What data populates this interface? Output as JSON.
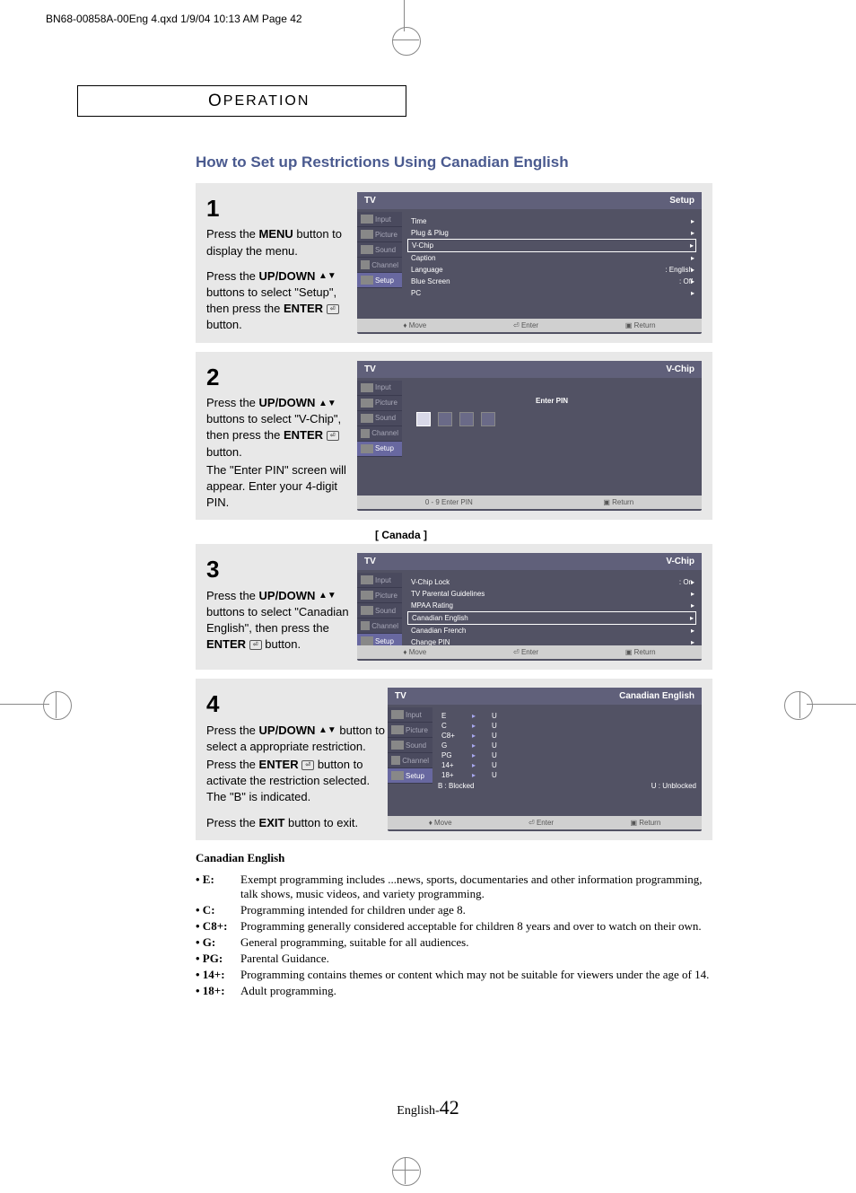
{
  "print_header": "BN68-00858A-00Eng 4.qxd  1/9/04 10:13 AM  Page 42",
  "section_header": "PERATION",
  "section_header_cap": "O",
  "page_title": "How to Set up Restrictions Using Canadian English",
  "steps": [
    {
      "num": "1",
      "para1": "Press the <b>MENU</b> button to display the menu.",
      "para2": "Press the <b>UP/DOWN</b> ▲▼ buttons to select \"Setup\", then press the <b>ENTER</b> ⏎ button."
    },
    {
      "num": "2",
      "para1": "Press the <b>UP/DOWN</b> ▲▼ buttons to select \"V-Chip\", then press the <b>ENTER</b> ⏎ button.",
      "para2": "The \"Enter PIN\" screen will appear. Enter your 4-digit PIN."
    },
    {
      "num": "3",
      "para1": "Press the <b>UP/DOWN</b> ▲▼ buttons to select \"Canadian English\", then press the <b>ENTER</b> ⏎ button."
    },
    {
      "num": "4",
      "para1": "Press the <b>UP/DOWN</b> ▲▼ button to select a appropriate restriction.",
      "para2": "Press the <b>ENTER</b> ⏎ button to activate the restriction selected. The \"B\" is indicated.",
      "para3": "Press the <b>EXIT</b> button to exit."
    }
  ],
  "menu_screens": {
    "screen1": {
      "title_left": "TV",
      "title_right": "Setup",
      "sidebar": [
        "Input",
        "Picture",
        "Sound",
        "Channel",
        "Setup"
      ],
      "items": [
        {
          "label": "Time",
          "value": ""
        },
        {
          "label": "Plug & Plug",
          "value": ""
        },
        {
          "label": "V-Chip",
          "value": "",
          "highlighted": true
        },
        {
          "label": "Caption",
          "value": ""
        },
        {
          "label": "Language",
          "value": ": English"
        },
        {
          "label": "Blue Screen",
          "value": ": Off"
        },
        {
          "label": "PC",
          "value": ""
        }
      ],
      "footer": [
        "Move",
        "Enter",
        "Return"
      ]
    },
    "screen2": {
      "title_left": "TV",
      "title_right": "V-Chip",
      "sidebar": [
        "Input",
        "Picture",
        "Sound",
        "Channel",
        "Setup"
      ],
      "content_label": "Enter PIN",
      "footer": [
        "0 - 9 Enter PIN",
        "Return"
      ]
    },
    "screen3": {
      "caption": "[ Canada ]",
      "title_left": "TV",
      "title_right": "V-Chip",
      "sidebar": [
        "Input",
        "Picture",
        "Sound",
        "Channel",
        "Setup"
      ],
      "items": [
        {
          "label": "V-Chip Lock",
          "value": ": On"
        },
        {
          "label": "TV Parental Guidelines",
          "value": ""
        },
        {
          "label": "MPAA Rating",
          "value": ""
        },
        {
          "label": "Canadian English",
          "value": "",
          "highlighted": true
        },
        {
          "label": "Canadian French",
          "value": ""
        },
        {
          "label": "Change PIN",
          "value": ""
        }
      ],
      "footer": [
        "Move",
        "Enter",
        "Return"
      ]
    },
    "screen4": {
      "title_left": "TV",
      "title_right": "Canadian English",
      "sidebar": [
        "Input",
        "Picture",
        "Sound",
        "Channel",
        "Setup"
      ],
      "ratings": [
        {
          "code": "E",
          "status": "U"
        },
        {
          "code": "C",
          "status": "U"
        },
        {
          "code": "C8+",
          "status": "U"
        },
        {
          "code": "G",
          "status": "U"
        },
        {
          "code": "PG",
          "status": "U"
        },
        {
          "code": "14+",
          "status": "U"
        },
        {
          "code": "18+",
          "status": "U"
        }
      ],
      "legend_b": "B : Blocked",
      "legend_u": "U : Unblocked",
      "footer": [
        "Move",
        "Enter",
        "Return"
      ]
    }
  },
  "definitions": {
    "title": "Canadian English",
    "items": [
      {
        "code": "• E:",
        "text": "Exempt programming includes ...news, sports, documentaries and other information programming, talk shows, music videos, and variety programming."
      },
      {
        "code": "• C:",
        "text": "Programming intended for children under age 8."
      },
      {
        "code": "• C8+:",
        "text": "Programming generally considered acceptable for children 8 years and over to watch on their own."
      },
      {
        "code": "• G:",
        "text": "General programming, suitable for all audiences."
      },
      {
        "code": "• PG:",
        "text": "Parental Guidance."
      },
      {
        "code": "• 14+:",
        "text": "Programming contains themes or content which may not be suitable for viewers under the age of 14."
      },
      {
        "code": "• 18+:",
        "text": "Adult programming."
      }
    ]
  },
  "page_footer": {
    "prefix": "English-",
    "num": "42"
  }
}
